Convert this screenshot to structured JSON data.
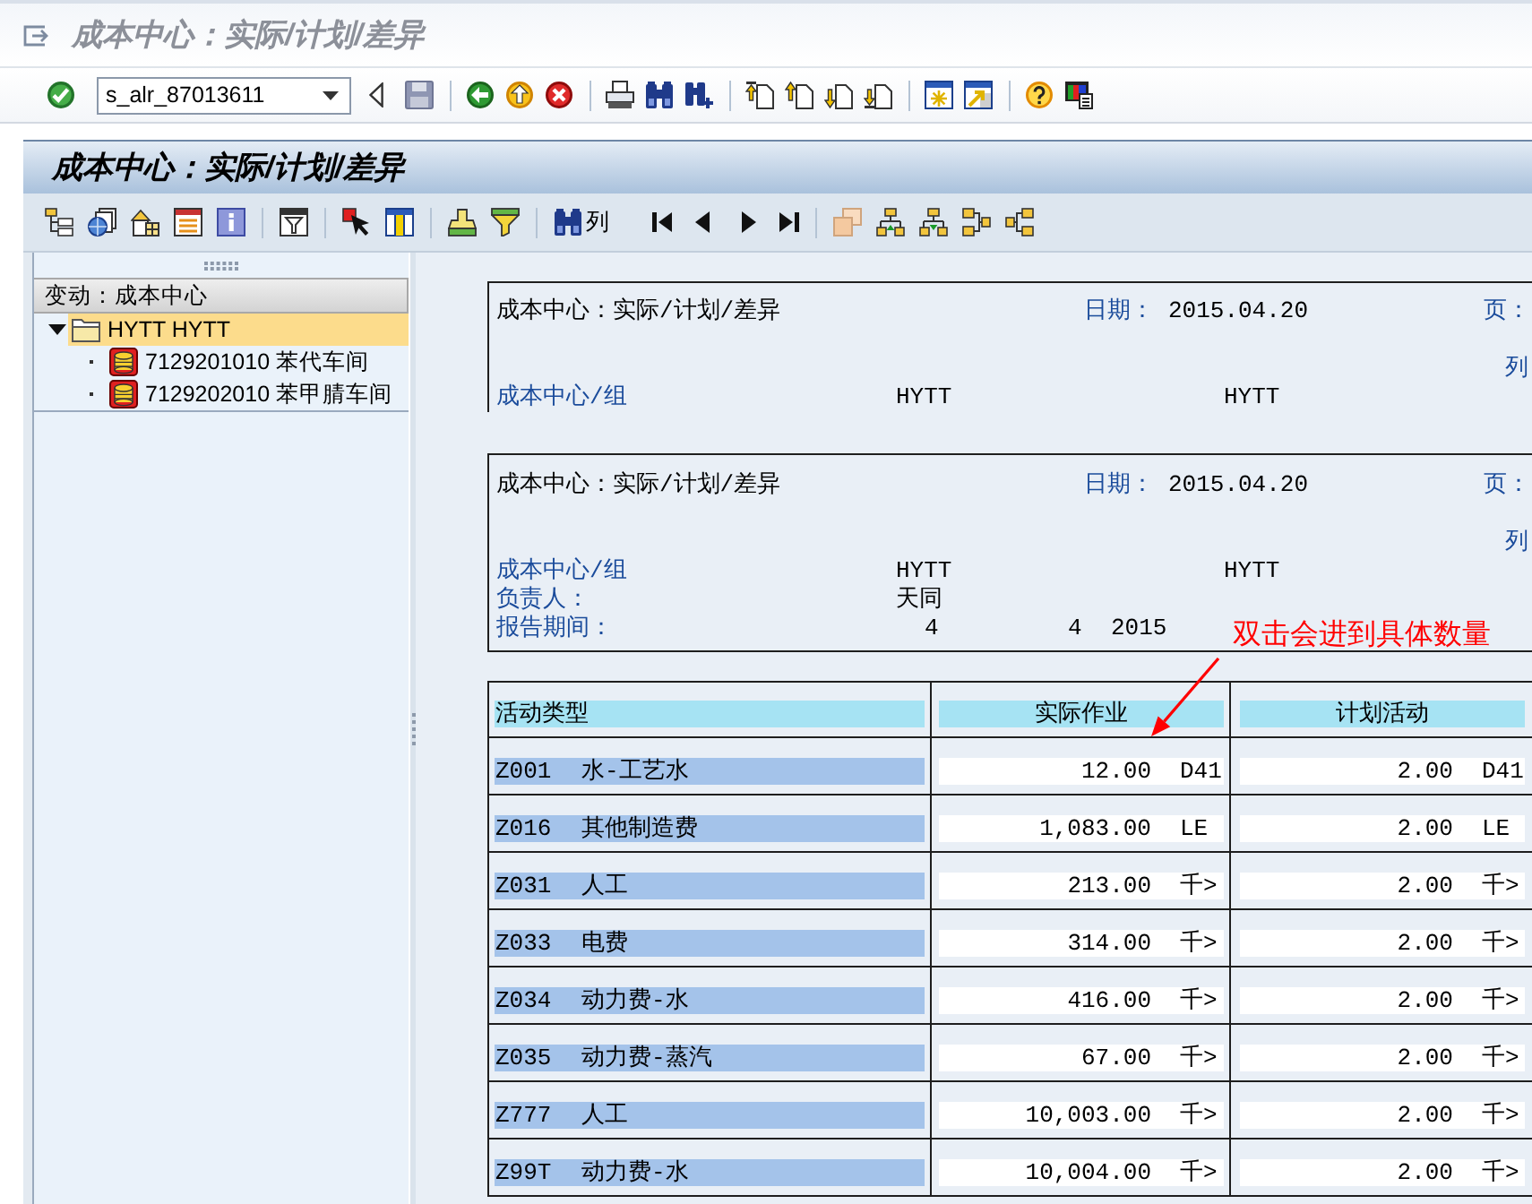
{
  "window": {
    "title": "成本中心：实际/计划/差异"
  },
  "command_field": {
    "value": "s_alr_87013611"
  },
  "screen": {
    "title": "成本中心：实际/计划/差异"
  },
  "application_toolbar": {
    "find_column_label": "列"
  },
  "tree": {
    "header": "变动：成本中心",
    "nodes": [
      {
        "label": "HYTT HYTT",
        "kind": "group",
        "expanded": true,
        "selected": true,
        "children": [
          {
            "label": "7129201010 苯代车间",
            "kind": "cost_center",
            "selected": false
          },
          {
            "label": "7129202010 苯甲腈车间",
            "kind": "cost_center",
            "selected": false
          }
        ]
      }
    ]
  },
  "report": {
    "headers": [
      {
        "title": "成本中心：实际/计划/差异",
        "date_label": "日期：",
        "date": "2015.04.20",
        "page_label": "页：",
        "column_label": "列",
        "fields": [
          {
            "label": "成本中心/组",
            "kind": "pair",
            "values": [
              "HYTT",
              "HYTT"
            ]
          }
        ]
      },
      {
        "title": "成本中心：实际/计划/差异",
        "date_label": "日期：",
        "date": "2015.04.20",
        "page_label": "页：",
        "column_label": "列",
        "fields": [
          {
            "label": "成本中心/组",
            "kind": "pair",
            "values": [
              "HYTT",
              "HYTT"
            ]
          },
          {
            "label": "负责人：",
            "kind": "single",
            "values": [
              "天同"
            ]
          },
          {
            "label": "报告期间：",
            "kind": "period",
            "values": [
              "4",
              "4",
              "2015"
            ]
          }
        ]
      }
    ],
    "table": {
      "columns": [
        "活动类型",
        "实际作业",
        "计划活动"
      ],
      "rows": [
        {
          "code": "Z001",
          "name": "水-工艺水",
          "actual": "12.00",
          "actual_unit": "D41",
          "plan": "2.00",
          "plan_unit": "D41"
        },
        {
          "code": "Z016",
          "name": "其他制造费",
          "actual": "1,083.00",
          "actual_unit": "LE",
          "plan": "2.00",
          "plan_unit": "LE"
        },
        {
          "code": "Z031",
          "name": "人工",
          "actual": "213.00",
          "actual_unit": "千>",
          "plan": "2.00",
          "plan_unit": "千>"
        },
        {
          "code": "Z033",
          "name": "电费",
          "actual": "314.00",
          "actual_unit": "千>",
          "plan": "2.00",
          "plan_unit": "千>"
        },
        {
          "code": "Z034",
          "name": "动力费-水",
          "actual": "416.00",
          "actual_unit": "千>",
          "plan": "2.00",
          "plan_unit": "千>"
        },
        {
          "code": "Z035",
          "name": "动力费-蒸汽",
          "actual": "67.00",
          "actual_unit": "千>",
          "plan": "2.00",
          "plan_unit": "千>"
        },
        {
          "code": "Z777",
          "name": "人工",
          "actual": "10,003.00",
          "actual_unit": "千>",
          "plan": "2.00",
          "plan_unit": "千>"
        },
        {
          "code": "Z99T",
          "name": "动力费-水",
          "actual": "10,004.00",
          "actual_unit": "千>",
          "plan": "2.00",
          "plan_unit": "千>"
        }
      ]
    }
  },
  "annotation": {
    "text": "双击会进到具体数量"
  }
}
